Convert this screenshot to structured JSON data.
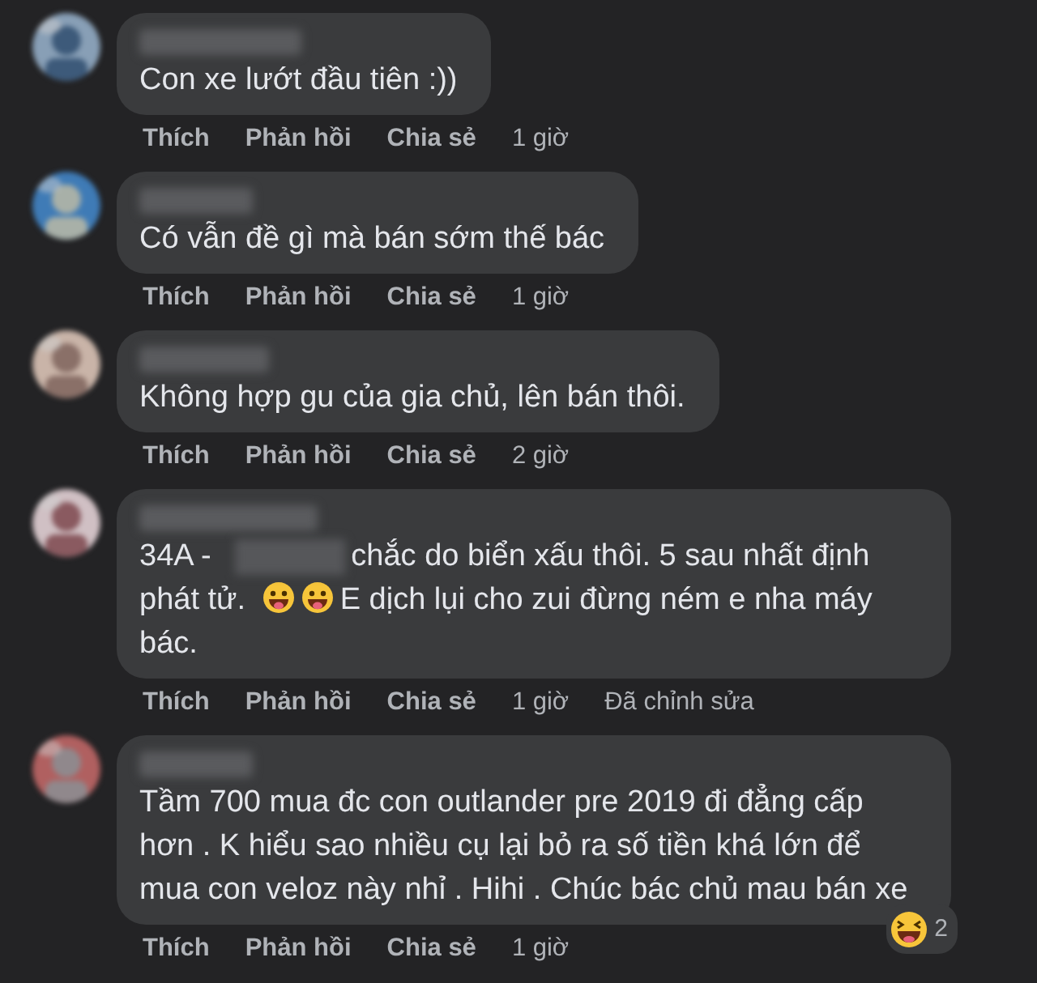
{
  "comments": [
    {
      "author_redacted": true,
      "parts": [
        {
          "kind": "text",
          "text": "Con xe lướt đầu tiên :))"
        }
      ],
      "actions": [
        "Thích",
        "Phản hồi",
        "Chia sẻ"
      ],
      "time": "1 giờ"
    },
    {
      "author_redacted": true,
      "parts": [
        {
          "kind": "text",
          "text": "Có vẫn đề gì mà bán sớm thế bác"
        }
      ],
      "actions": [
        "Thích",
        "Phản hồi",
        "Chia sẻ"
      ],
      "time": "1 giờ"
    },
    {
      "author_redacted": true,
      "parts": [
        {
          "kind": "text",
          "text": "Không hợp gu của gia chủ, lên bán thôi."
        }
      ],
      "actions": [
        "Thích",
        "Phản hồi",
        "Chia sẻ"
      ],
      "time": "2 giờ"
    },
    {
      "author_redacted": true,
      "parts": [
        {
          "kind": "text",
          "text": "34A -"
        },
        {
          "kind": "redacted"
        },
        {
          "kind": "text",
          "text": "chắc do biển xấu thôi. 5 sau nhất định"
        },
        {
          "kind": "text",
          "text": "phát tử."
        },
        {
          "kind": "emoji"
        },
        {
          "kind": "emoji"
        },
        {
          "kind": "text",
          "text": "E dịch lụi cho zui đừng ném e nha máy"
        },
        {
          "kind": "text",
          "text": "bác."
        }
      ],
      "actions": [
        "Thích",
        "Phản hồi",
        "Chia sẻ"
      ],
      "time": "1 giờ",
      "edited": "Đã chỉnh sửa"
    },
    {
      "author_redacted": true,
      "parts": [
        {
          "kind": "text",
          "text": "Tầm 700 mua đc con outlander pre 2019 đi đẳng cấp hơn . K hiểu sao nhiều cụ lại bỏ ra số tiền khá lớn để mua con veloz này nhỉ . Hihi . Chúc bác chủ mau bán xe"
        }
      ],
      "actions": [
        "Thích",
        "Phản hồi",
        "Chia sẻ"
      ],
      "time": "1 giờ",
      "reaction": {
        "count": "2"
      }
    }
  ]
}
